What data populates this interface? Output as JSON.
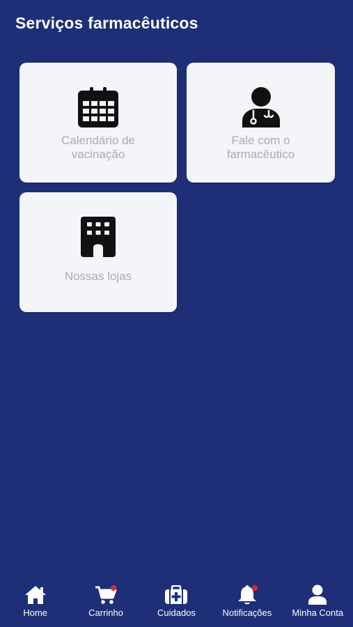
{
  "header": {
    "title": "Serviços farmacêuticos"
  },
  "services": [
    {
      "label": "Calendário de\nvacinação",
      "icon": "calendar-icon"
    },
    {
      "label": "Fale com o\nfarmacêutico",
      "icon": "doctor-icon"
    },
    {
      "label": "Nossas lojas",
      "icon": "building-icon"
    }
  ],
  "bottom_nav": [
    {
      "label": "Home",
      "icon": "home-icon",
      "badge": false
    },
    {
      "label": "Carrinho",
      "icon": "cart-icon",
      "badge": true
    },
    {
      "label": "Cuidados",
      "icon": "medical-kit-icon",
      "badge": false
    },
    {
      "label": "Notificações",
      "icon": "bell-icon",
      "badge": true
    },
    {
      "label": "Minha Conta",
      "icon": "user-icon",
      "badge": false
    }
  ],
  "colors": {
    "background": "#1e2f78",
    "card": "#f4f5f9",
    "card_text": "#a9abb1",
    "badge": "#e3262c",
    "nav_text": "#ffffff"
  }
}
